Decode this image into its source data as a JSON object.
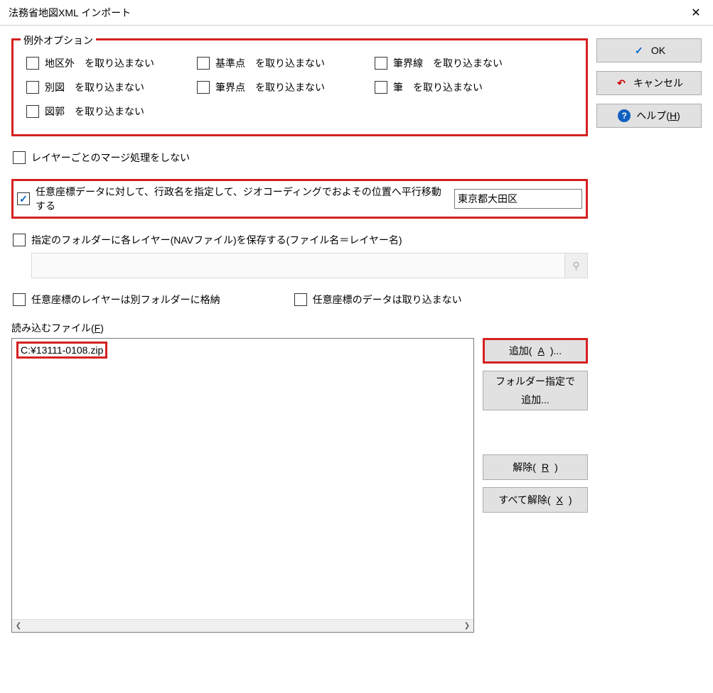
{
  "title": "法務省地図XML インポート",
  "buttons": {
    "ok": "OK",
    "cancel": "キャンセル",
    "help": "ヘルプ(H)"
  },
  "exception_group": {
    "legend": "例外オプション",
    "items": {
      "chikugai": "地区外　を取り込まない",
      "betsuzu": "別図　を取り込まない",
      "zukaku": "図郭　を取り込まない",
      "kijunten": "基準点　を取り込まない",
      "hikkaiten": "筆界点　を取り込まない",
      "hikkaisen": "筆界線　を取り込まない",
      "fude": "筆　を取り込まない"
    }
  },
  "options": {
    "no_merge": "レイヤーごとのマージ処理をしない",
    "geocode": "任意座標データに対して、行政名を指定して、ジオコーディングでおよその位置へ平行移動する",
    "geocode_value": "東京都大田区",
    "save_folder": "指定のフォルダーに各レイヤー(NAVファイル)を保存する(ファイル名＝レイヤー名)",
    "arb_layer_other_folder": "任意座標のレイヤーは別フォルダーに格納",
    "arb_data_no_import": "任意座標のデータは取り込まない"
  },
  "files": {
    "label": "読み込むファイル(F)",
    "items": [
      "C:¥13111-0108.zip"
    ],
    "add": "追加(A)...",
    "add_folder_l1": "フォルダー指定で",
    "add_folder_l2": "追加...",
    "remove": "解除(R)",
    "remove_all": "すべて解除(X)"
  }
}
